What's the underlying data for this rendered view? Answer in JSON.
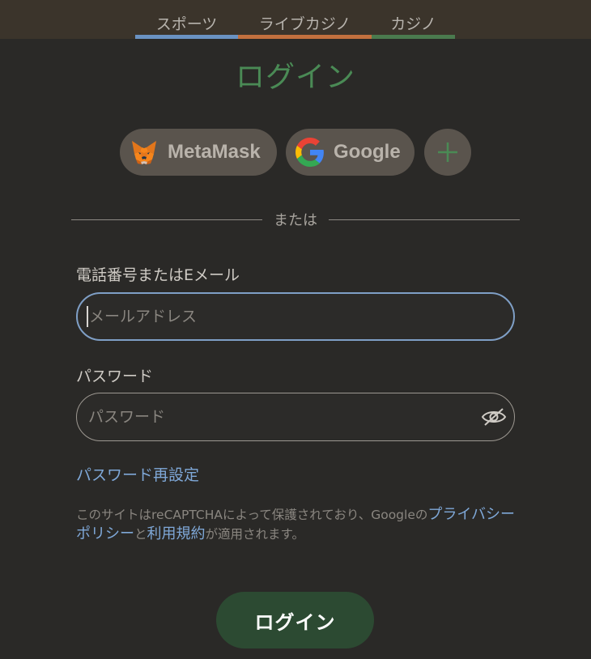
{
  "tabs": [
    {
      "label": "スポーツ",
      "color": "#6a92c2"
    },
    {
      "label": "ライブカジノ",
      "color": "#c2703e"
    },
    {
      "label": "カジノ",
      "color": "#4a7a4e"
    }
  ],
  "title": "ログイン",
  "social": {
    "metamask_label": "MetaMask",
    "google_label": "Google",
    "more_icon": "plus-icon"
  },
  "divider_text": "または",
  "email": {
    "label": "電話番号またはEメール",
    "placeholder": "メールアドレス",
    "value": ""
  },
  "password": {
    "label": "パスワード",
    "placeholder": "パスワード",
    "value": "",
    "toggle_icon": "eye-off-icon"
  },
  "reset_link": "パスワード再設定",
  "recaptcha": {
    "prefix": "このサイトはreCAPTCHAによって保護されており、Googleの",
    "privacy_link": "プライバシーポリシー",
    "and": "と",
    "terms_link": "利用規約",
    "suffix": "が適用されます。"
  },
  "login_button": "ログイン",
  "colors": {
    "accent_green": "#4a8a55",
    "link_blue": "#7fa8d8",
    "button_green": "#2c4a32",
    "focus_blue": "#7f9fc6"
  }
}
